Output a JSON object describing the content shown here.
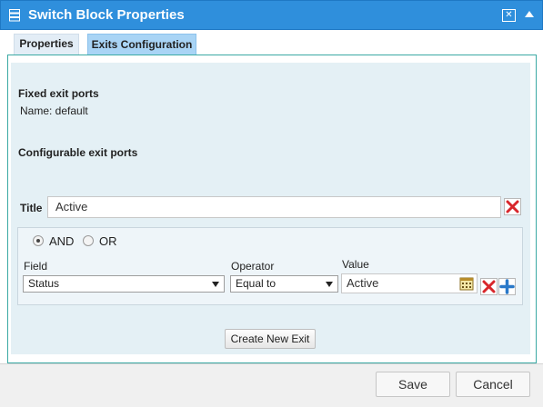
{
  "dialog": {
    "title": "Switch Block Properties"
  },
  "tabs": [
    {
      "label": "Properties",
      "active": false
    },
    {
      "label": "Exits Configuration",
      "active": true
    }
  ],
  "fixed_exits": {
    "heading": "Fixed exit ports",
    "name_text": "Name: default"
  },
  "configurable_exits": {
    "heading": "Configurable exit ports"
  },
  "exit": {
    "title_label": "Title",
    "title_value": "Active",
    "logic": {
      "and_label": "AND",
      "or_label": "OR",
      "selected": "AND"
    },
    "condition": {
      "field_label": "Field",
      "field_value": "Status",
      "operator_label": "Operator",
      "operator_value": "Equal to",
      "value_label": "Value",
      "value_value": "Active"
    }
  },
  "buttons": {
    "create_new_exit": "Create New Exit",
    "save": "Save",
    "cancel": "Cancel"
  },
  "colors": {
    "titlebar": "#2f8fdc",
    "active_tab": "#a9d4f5",
    "content_bg": "#e4f0f5",
    "delete_red": "#d8262b",
    "add_blue": "#2a79c9"
  }
}
